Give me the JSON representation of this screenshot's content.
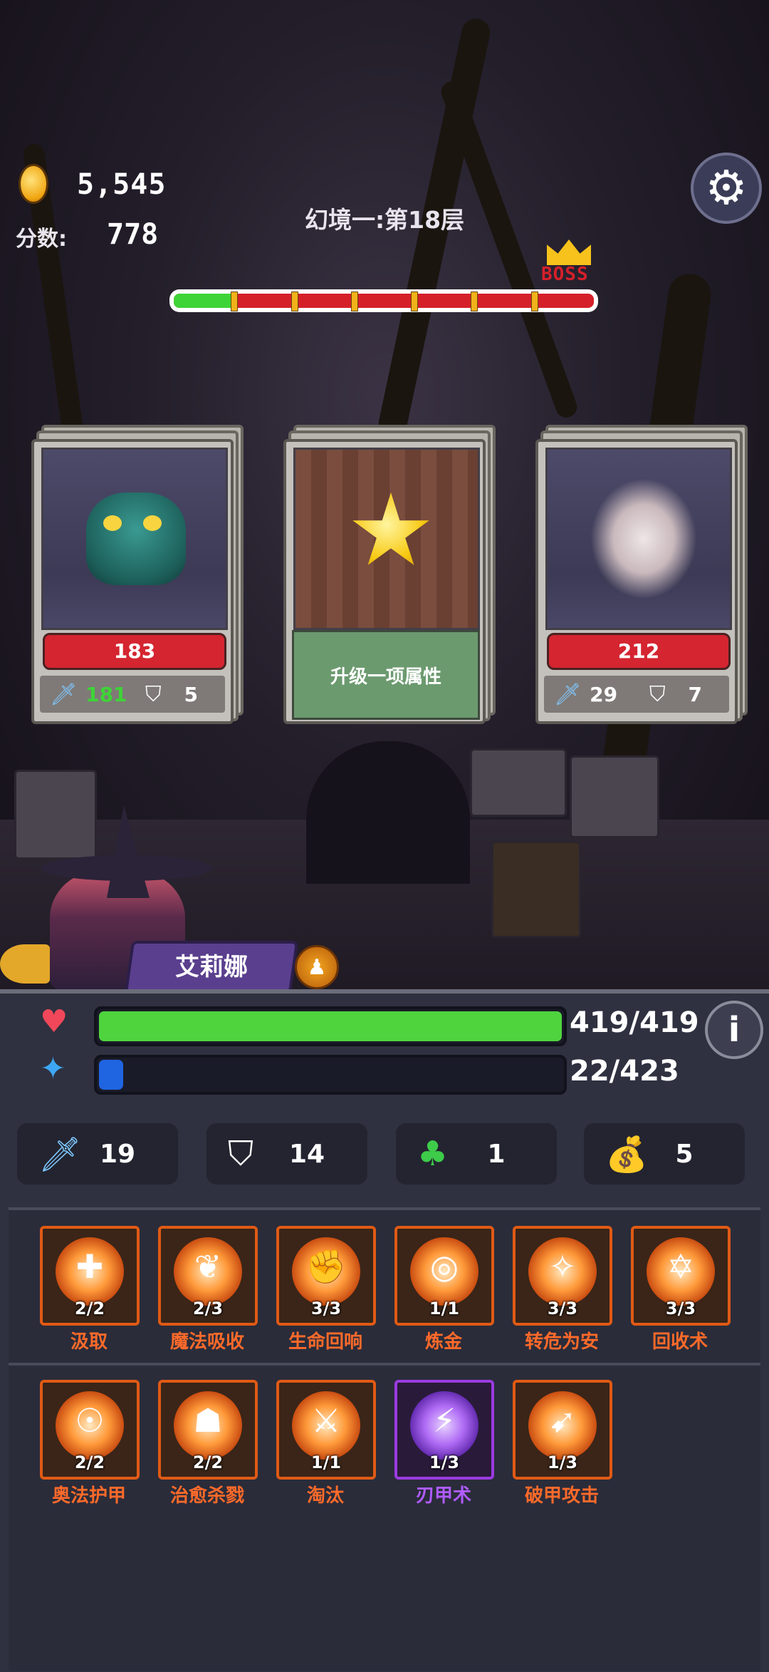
{
  "hud": {
    "coins": "5,545",
    "score_label": "分数:",
    "score": "778",
    "level_title": "幻境一:第18层",
    "boss_label": "BOSS"
  },
  "stage_progress": {
    "segments_total": 7,
    "current_segment": 1
  },
  "cards": [
    {
      "type": "enemy",
      "hp": "183",
      "attack": "181",
      "defense": "5",
      "attack_color": "#3ed437"
    },
    {
      "type": "upgrade",
      "label": "升级一项属性"
    },
    {
      "type": "enemy",
      "hp": "212",
      "attack": "29",
      "defense": "7",
      "attack_color": "#ffffff"
    }
  ],
  "character": {
    "name": "艾莉娜"
  },
  "player": {
    "hp": "419/419",
    "hp_fraction": 1.0,
    "mp": "22/423",
    "mp_fraction": 0.052
  },
  "stats": [
    {
      "icon": "sword-icon",
      "value": "19"
    },
    {
      "icon": "shield-icon",
      "value": "14"
    },
    {
      "icon": "clover-icon",
      "value": "1"
    },
    {
      "icon": "money-bag-icon",
      "value": "5"
    }
  ],
  "skills_row1": [
    {
      "name": "汲取",
      "count": "2/2",
      "glyph": "✚"
    },
    {
      "name": "魔法吸收",
      "count": "2/3",
      "glyph": "❦"
    },
    {
      "name": "生命回响",
      "count": "3/3",
      "glyph": "✊"
    },
    {
      "name": "炼金",
      "count": "1/1",
      "glyph": "◎"
    },
    {
      "name": "转危为安",
      "count": "3/3",
      "glyph": "✧"
    },
    {
      "name": "回收术",
      "count": "3/3",
      "glyph": "✡"
    }
  ],
  "skills_row2": [
    {
      "name": "奥法护甲",
      "count": "2/2",
      "glyph": "☉",
      "rarity": "orange"
    },
    {
      "name": "治愈杀戮",
      "count": "2/2",
      "glyph": "☗",
      "rarity": "orange"
    },
    {
      "name": "淘汰",
      "count": "1/1",
      "glyph": "⚔",
      "rarity": "orange"
    },
    {
      "name": "刃甲术",
      "count": "1/3",
      "glyph": "⚡",
      "rarity": "purple"
    },
    {
      "name": "破甲攻击",
      "count": "1/3",
      "glyph": "➹",
      "rarity": "orange"
    }
  ],
  "colors": {
    "hp_bar": "#4fd43e",
    "mp_bar": "#1f64e0",
    "skill_orange": "#ff6a2a",
    "skill_purple": "#b05cff"
  }
}
